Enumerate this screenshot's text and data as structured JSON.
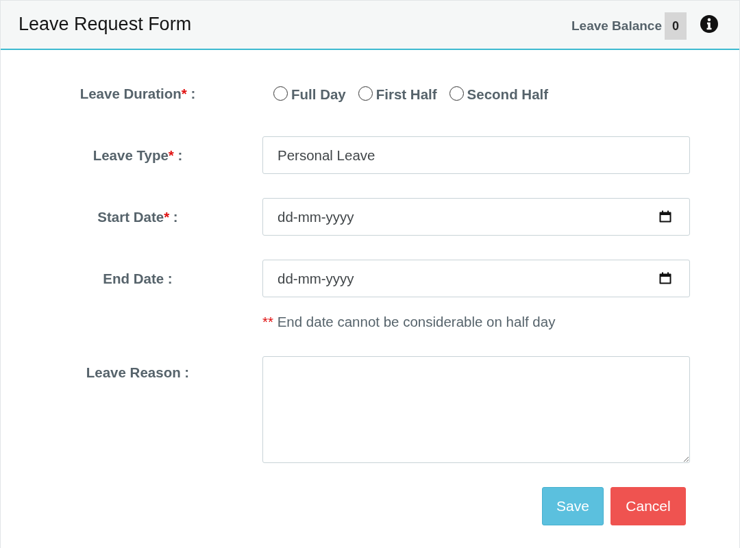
{
  "header": {
    "title": "Leave Request Form",
    "balance_label": "Leave Balance",
    "balance_value": "0"
  },
  "form": {
    "duration": {
      "label": "Leave Duration",
      "required_mark": "*",
      "suffix": ":",
      "options": [
        {
          "label": "Full Day",
          "selected": false
        },
        {
          "label": "First Half",
          "selected": false
        },
        {
          "label": "Second Half",
          "selected": false
        }
      ]
    },
    "fields": [
      {
        "kind": "text",
        "label": "Leave Type",
        "required_mark": "*",
        "suffix": ":",
        "value": "Personal Leave"
      },
      {
        "kind": "date",
        "label": "Start Date",
        "required_mark": "*",
        "suffix": ":",
        "placeholder": "dd-mm-yyyy"
      },
      {
        "kind": "date",
        "label": "End Date",
        "suffix": ":",
        "placeholder": "dd-mm-yyyy",
        "note": {
          "marker": "**",
          "text": "End date cannot be considerable on half day"
        }
      },
      {
        "kind": "textarea",
        "label": "Leave Reason",
        "suffix": ":"
      }
    ]
  },
  "buttons": [
    {
      "label": "Save",
      "kind": "primary"
    },
    {
      "label": "Cancel",
      "kind": "danger"
    }
  ]
}
